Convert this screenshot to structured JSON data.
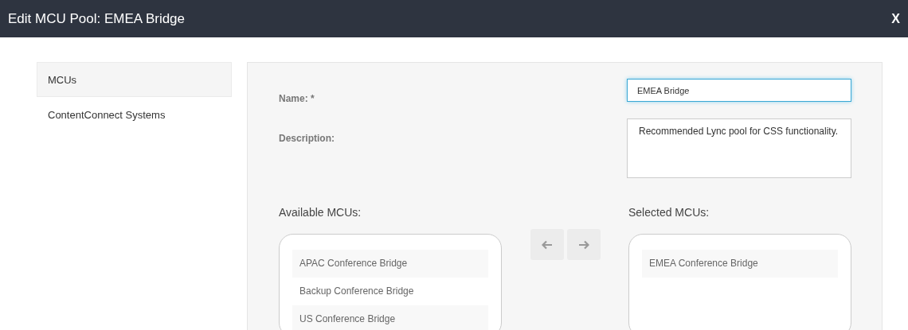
{
  "window": {
    "title": "Edit MCU Pool: EMEA Bridge",
    "close": "X"
  },
  "sidebar": {
    "items": [
      {
        "label": "MCUs",
        "selected": true
      },
      {
        "label": "ContentConnect Systems",
        "selected": false
      }
    ]
  },
  "form": {
    "name_label": "Name: *",
    "name_value": "EMEA Bridge",
    "description_label": "Description:",
    "description_value": "Recommended Lync pool for CSS functionality."
  },
  "available": {
    "label": "Available MCUs:",
    "items": [
      "APAC Conference Bridge",
      "Backup Conference Bridge",
      "US Conference Bridge"
    ]
  },
  "selected": {
    "label": "Selected MCUs:",
    "items": [
      "EMEA Conference Bridge"
    ]
  }
}
